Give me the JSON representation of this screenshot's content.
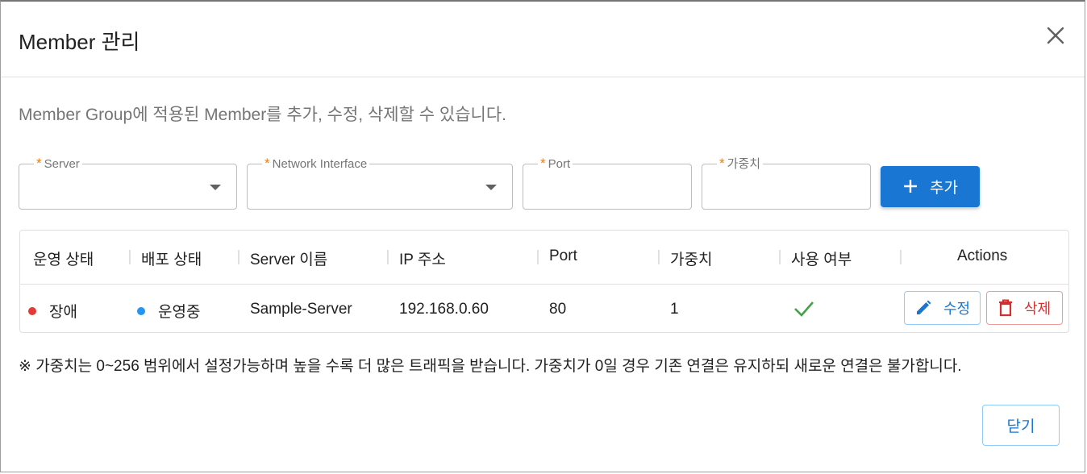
{
  "dialog": {
    "title": "Member 관리",
    "description": "Member Group에 적용된 Member를 추가, 수정, 삭제할 수 있습니다.",
    "close_icon": "close-icon"
  },
  "form": {
    "server": {
      "label": "Server",
      "required_mark": "*",
      "value": ""
    },
    "network_interface": {
      "label": "Network Interface",
      "required_mark": "*",
      "value": ""
    },
    "port": {
      "label": "Port",
      "required_mark": "*",
      "value": ""
    },
    "weight": {
      "label": "가중치",
      "required_mark": "*",
      "value": ""
    },
    "add_button": {
      "icon": "plus-icon",
      "label": "추가"
    }
  },
  "table": {
    "columns": [
      "운영 상태",
      "배포 상태",
      "Server 이름",
      "IP 주소",
      "Port",
      "가중치",
      "사용 여부",
      "Actions"
    ],
    "rows": [
      {
        "op_status": "장애",
        "op_status_color": "#e53935",
        "deploy_status": "운영중",
        "deploy_status_color": "#2196f3",
        "server_name": "Sample-Server",
        "ip": "192.168.0.60",
        "port": "80",
        "weight": "1",
        "enabled_icon": "check-icon",
        "enabled": true,
        "edit_label": "수정",
        "delete_label": "삭제"
      }
    ]
  },
  "note": "※ 가중치는 0~256 범위에서 설정가능하며 높을 수록 더 많은 트래픽을 받습니다. 가중치가 0일 경우 기존 연결은 유지하되 새로운 연결은 불가합니다.",
  "footer": {
    "close_label": "닫기"
  },
  "colors": {
    "primary": "#1976d2",
    "danger": "#d32f2f",
    "required": "#f57c00",
    "success": "#43a047"
  }
}
